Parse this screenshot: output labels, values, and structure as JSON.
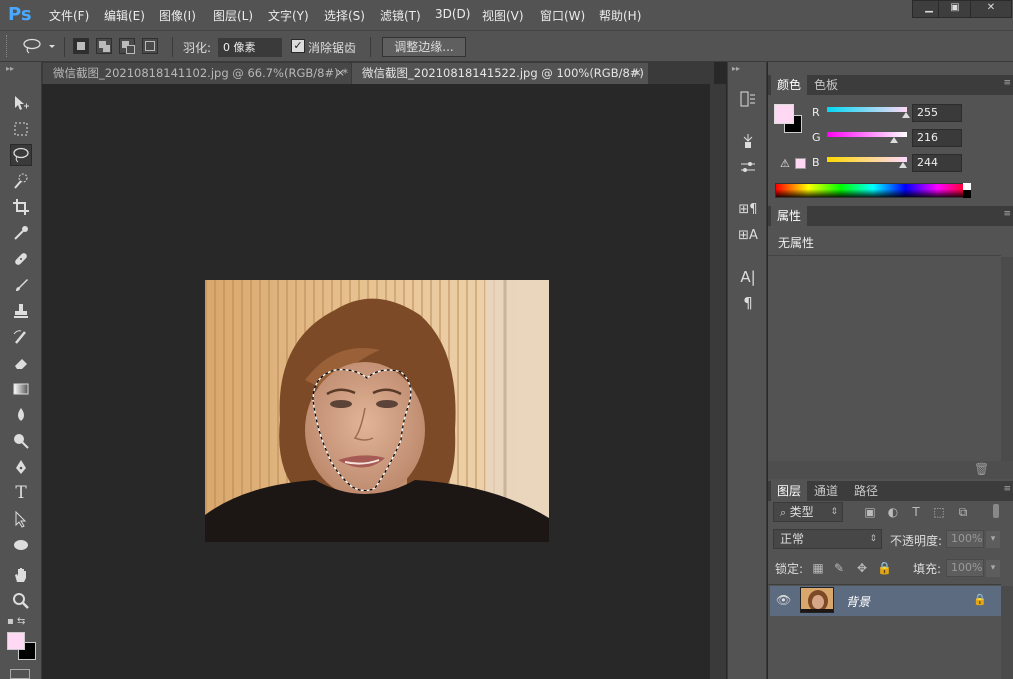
{
  "app": {
    "logo": "Ps"
  },
  "menu": [
    "文件(F)",
    "编辑(E)",
    "图像(I)",
    "图层(L)",
    "文字(Y)",
    "选择(S)",
    "滤镜(T)",
    "3D(D)",
    "视图(V)",
    "窗口(W)",
    "帮助(H)"
  ],
  "window_controls": {
    "minimize": "▁",
    "maximize": "▣",
    "close": "✕"
  },
  "options": {
    "feather_label": "羽化:",
    "feather_value": "0 像素",
    "antialias_label": "消除锯齿",
    "antialias_checked": true,
    "refine_edge_button": "调整边缘..."
  },
  "tabs": [
    {
      "label": "微信截图_20210818141102.jpg @ 66.7%(RGB/8#) *",
      "close": "×",
      "active": false
    },
    {
      "label": "微信截图_20210818141522.jpg @ 100%(RGB/8#)",
      "close": "×",
      "active": true
    }
  ],
  "color_panel": {
    "tabs": [
      "颜色",
      "色板"
    ],
    "r_label": "R",
    "r_value": "255",
    "g_label": "G",
    "g_value": "216",
    "b_label": "B",
    "b_value": "244",
    "foreground": "#ffd8f4",
    "background": "#000000"
  },
  "properties_panel": {
    "tab": "属性",
    "content": "无属性"
  },
  "layers_panel": {
    "tabs": [
      "图层",
      "通道",
      "路径"
    ],
    "filter_label": "类型",
    "blend_mode": "正常",
    "opacity_label": "不透明度:",
    "opacity_value": "100%",
    "lock_label": "锁定:",
    "fill_label": "填充:",
    "fill_value": "100%",
    "layers": [
      {
        "name": "背景",
        "visible": true,
        "locked": true
      }
    ]
  },
  "colors": {
    "accent_ps": "#4aa8ff",
    "selected_layer": "#5c6b80"
  }
}
